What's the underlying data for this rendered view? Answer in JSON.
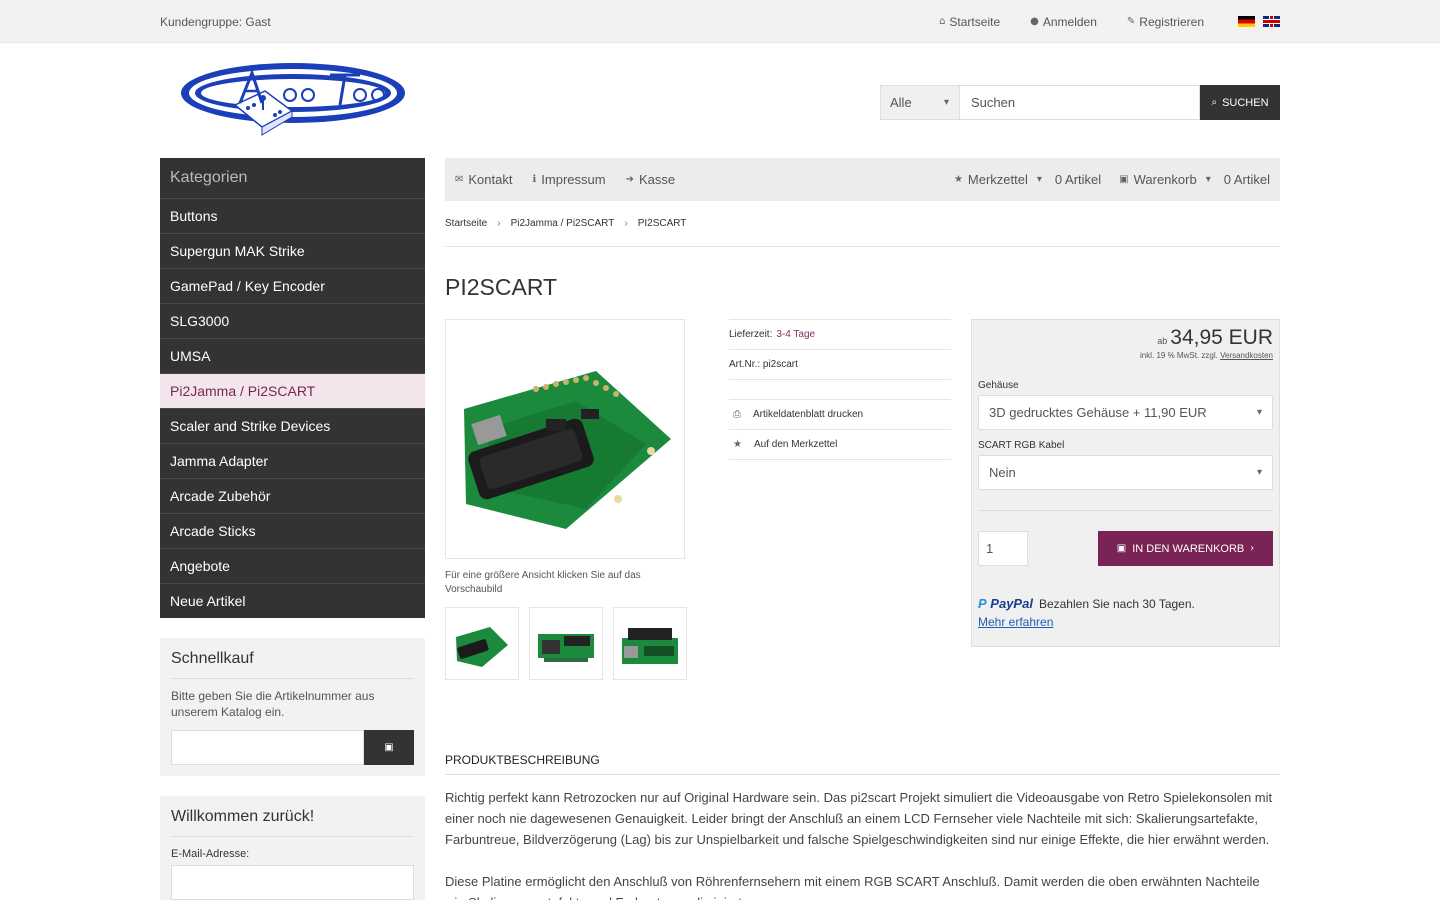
{
  "topbar": {
    "customer_group": "Kundengruppe: Gast",
    "links": [
      {
        "icon": "home-icon",
        "label": "Startseite"
      },
      {
        "icon": "user-icon",
        "label": "Anmelden"
      },
      {
        "icon": "pencil-icon",
        "label": "Registrieren"
      }
    ],
    "languages": [
      "de",
      "en"
    ]
  },
  "search": {
    "category": "Alle",
    "placeholder": "Suchen",
    "button_label": "SUCHEN"
  },
  "sidebar": {
    "categories_title": "Kategorien",
    "categories": [
      "Buttons",
      "Supergun MAK Strike",
      "GamePad / Key Encoder",
      "SLG3000",
      "UMSA",
      "Pi2Jamma / Pi2SCART",
      "Scaler and Strike Devices",
      "Jamma Adapter",
      "Arcade Zubehör",
      "Arcade Sticks",
      "Angebote",
      "Neue Artikel"
    ],
    "active_category": "Pi2Jamma / Pi2SCART",
    "quickbuy": {
      "title": "Schnellkauf",
      "text": "Bitte geben Sie die Artikelnummer aus unserem Katalog ein."
    },
    "login": {
      "title": "Willkommen zurück!",
      "email_label": "E-Mail-Adresse:"
    }
  },
  "navbar": {
    "links": [
      "Kontakt",
      "Impressum",
      "Kasse"
    ],
    "wishlist_label": "Merkzettel",
    "wishlist_count": "0 Artikel",
    "cart_label": "Warenkorb",
    "cart_count": "0 Artikel"
  },
  "breadcrumb": [
    "Startseite",
    "Pi2Jamma / Pi2SCART",
    "PI2SCART"
  ],
  "product": {
    "title": "PI2SCART",
    "image_caption": "Für eine größere Ansicht klicken Sie auf das Vorschaubild",
    "delivery_label": "Lieferzeit:",
    "delivery_value": "3-4 Tage",
    "sku": "Art.Nr.: pi2scart",
    "print_link": "Artikeldatenblatt drucken",
    "wishlist_link": "Auf den Merkzettel",
    "price_prefix": "ab",
    "price": "34,95 EUR",
    "tax_text": "inkl. 19 % MwSt. zzgl.",
    "shipping_link": "Versandkosten",
    "option1_label": "Gehäuse",
    "option1_value": "3D gedrucktes Gehäuse + 11,90 EUR",
    "option2_label": "SCART RGB Kabel",
    "option2_value": "Nein",
    "quantity": "1",
    "cart_button": "IN DEN WARENKORB",
    "paypal_brand": "PayPal",
    "paypal_text": "Bezahlen Sie nach 30 Tagen.",
    "paypal_more": "Mehr erfahren"
  },
  "description": {
    "heading": "PRODUKTBESCHREIBUNG",
    "paragraph1": "Richtig perfekt kann Retrozocken nur auf Original Hardware sein. Das pi2scart Projekt simuliert die Videoausgabe von Retro Spielekonsolen mit einer noch nie dagewesenen Genauigkeit. Leider bringt der Anschluß an einem LCD Fernseher viele Nachteile mit sich: Skalierungsartefakte, Farbuntreue, Bildverzögerung (Lag) bis zur Unspielbarkeit und falsche Spielgeschwindigkeiten sind nur einige Effekte, die hier erwähnt werden.",
    "paragraph2": "Diese Platine ermöglicht den Anschluß von Röhrenfernsehern mit einem RGB SCART Anschluß. Damit werden die oben erwähnten Nachteile wie Skalierungsartefakte und Farbuntreue eliminiert."
  },
  "colors": {
    "dark": "#333333",
    "accent": "#7a2356",
    "active_bg": "#f2e6ec"
  }
}
